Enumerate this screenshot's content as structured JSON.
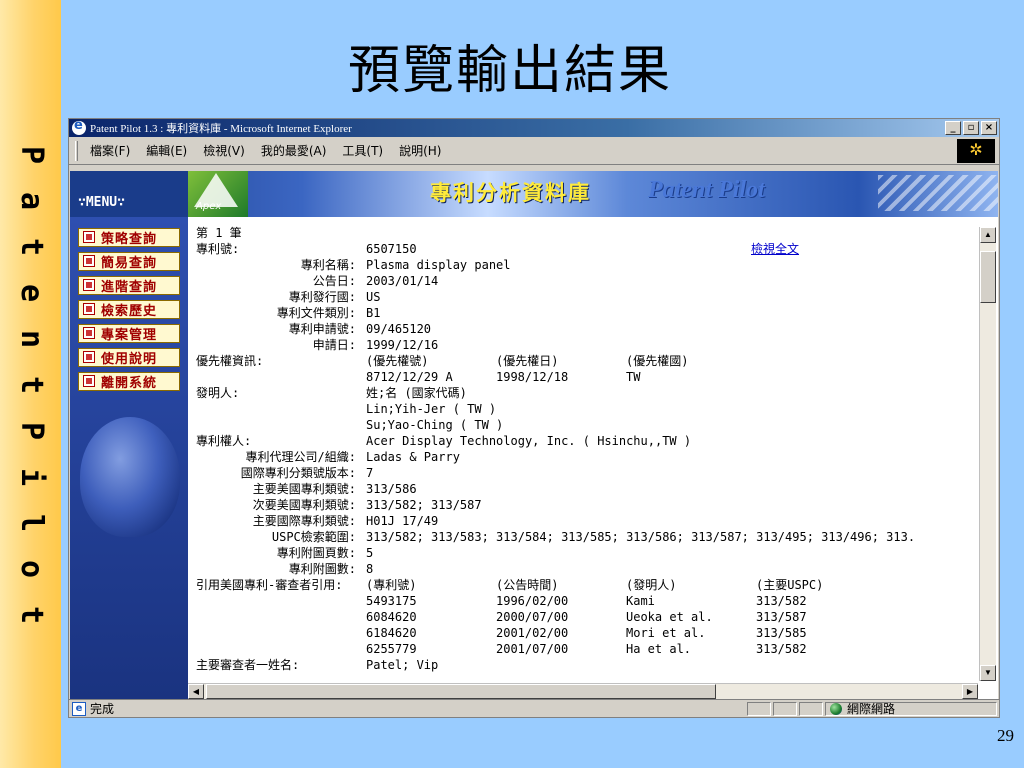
{
  "slide": {
    "title": "預覽輸出結果",
    "page_number": "29",
    "side_letters": [
      "P",
      "a",
      "t",
      "e",
      "n",
      "t",
      "P",
      "i",
      "l",
      "o",
      "t"
    ]
  },
  "window": {
    "title": "Patent Pilot 1.3 : 專利資料庫 - Microsoft Internet Explorer",
    "buttons": {
      "minimize": "_",
      "maximize": "▫",
      "close": "×"
    },
    "menu": [
      "檔案(F)",
      "編輯(E)",
      "檢視(V)",
      "我的最愛(A)",
      "工具(T)",
      "說明(H)"
    ]
  },
  "banner": {
    "menu_label": "∵MENU∵",
    "apex_label": "Apex",
    "title_zh": "專利分析資料庫",
    "title_en": "Patent Pilot"
  },
  "nav": [
    "策略查詢",
    "簡易查詢",
    "進階查詢",
    "檢索歷史",
    "專案管理",
    "使用說明",
    "離開系統"
  ],
  "record": {
    "heading": "第 1 筆",
    "view_full_text": "檢視全文",
    "fields": [
      {
        "label": "專利號:",
        "align": "left",
        "value": "6507150"
      },
      {
        "label": "專利名稱:",
        "value": "Plasma display panel"
      },
      {
        "label": "公告日:",
        "value": "2003/01/14"
      },
      {
        "label": "專利發行國:",
        "value": "US"
      },
      {
        "label": "專利文件類別:",
        "value": "B1"
      },
      {
        "label": "專利申請號:",
        "value": "09/465120"
      },
      {
        "label": "申請日:",
        "value": "1999/12/16"
      }
    ],
    "priority": {
      "label": "優先權資訊:",
      "headers": [
        "(優先權號)",
        "(優先權日)",
        "(優先權國)"
      ],
      "row": [
        "8712/12/29 A",
        "1998/12/18",
        "TW"
      ]
    },
    "inventors": {
      "label": "發明人:",
      "header": "姓;名 (國家代碼)",
      "names": [
        "Lin;Yih-Jer ( TW )",
        "Su;Yao-Ching ( TW )"
      ]
    },
    "fields2": [
      {
        "label": "專利權人:",
        "align": "left",
        "value": "Acer Display Technology, Inc. ( Hsinchu,,TW )"
      },
      {
        "label": "專利代理公司/組織:",
        "value": "Ladas & Parry"
      },
      {
        "label": "國際專利分類號版本:",
        "value": "7"
      },
      {
        "label": "主要美國專利類號:",
        "value": "313/586"
      },
      {
        "label": "次要美國專利類號:",
        "value": "313/582; 313/587"
      },
      {
        "label": "主要國際專利類號:",
        "value": "H01J 17/49"
      },
      {
        "label": "USPC檢索範圍:",
        "value": "313/582; 313/583; 313/584; 313/585; 313/586; 313/587; 313/495; 313/496; 313."
      },
      {
        "label": "專利附圖頁數:",
        "value": "5"
      },
      {
        "label": "專利附圖數:",
        "value": "8"
      }
    ],
    "citations": {
      "label": "引用美國專利-審查者引用:",
      "headers": [
        "(專利號)",
        "(公告時間)",
        "(發明人)",
        "(主要USPC)"
      ],
      "rows": [
        [
          "5493175",
          "1996/02/00",
          "Kami",
          "313/582"
        ],
        [
          "6084620",
          "2000/07/00",
          "Ueoka et al.",
          "313/587"
        ],
        [
          "6184620",
          "2001/02/00",
          "Mori et al.",
          "313/585"
        ],
        [
          "6255779",
          "2001/07/00",
          "Ha et al.",
          "313/582"
        ]
      ]
    },
    "examiner": {
      "label": "主要審查者一姓名:",
      "value": "Patel; Vip"
    }
  },
  "status": {
    "text": "完成",
    "zone": "網際網路"
  }
}
